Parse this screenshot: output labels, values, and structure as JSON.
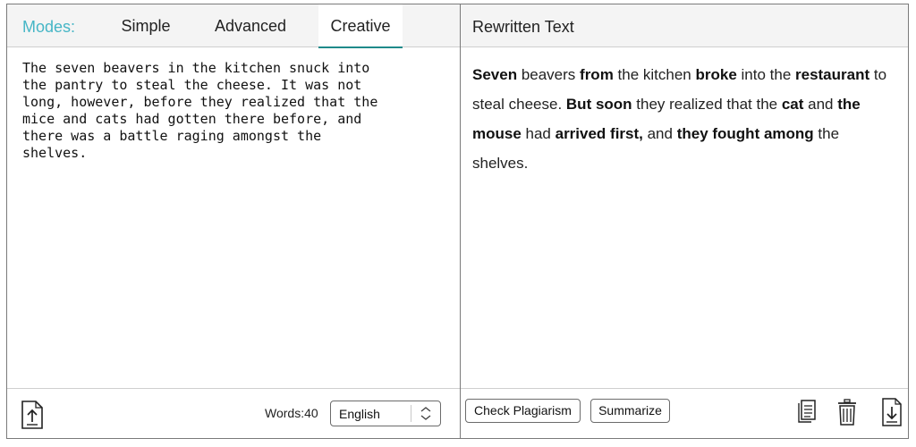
{
  "modes": {
    "label": "Modes:",
    "tabs": [
      {
        "label": "Simple"
      },
      {
        "label": "Advanced"
      },
      {
        "label": "Creative"
      }
    ],
    "active_tab": "Creative",
    "accent_color": "#46b6c6",
    "active_underline_color": "#1f8a8a"
  },
  "input": {
    "text": "The seven beavers in the kitchen snuck into\nthe pantry to steal the cheese. It was not\nlong, however, before they realized that the\nmice and cats had gotten there before, and\nthere was a battle raging amongst the\nshelves.",
    "words_label": "Words:",
    "words_count": "40",
    "language": "English"
  },
  "output": {
    "title": "Rewritten Text",
    "segments": [
      {
        "text": "Seven",
        "bold": true
      },
      {
        "text": " beavers ",
        "bold": false
      },
      {
        "text": "from",
        "bold": true
      },
      {
        "text": " the kitchen ",
        "bold": false
      },
      {
        "text": "broke",
        "bold": true
      },
      {
        "text": " into the ",
        "bold": false
      },
      {
        "text": "restaurant",
        "bold": true
      },
      {
        "text": " to steal cheese. ",
        "bold": false
      },
      {
        "text": "But soon",
        "bold": true
      },
      {
        "text": " they realized that the ",
        "bold": false
      },
      {
        "text": "cat",
        "bold": true
      },
      {
        "text": " and ",
        "bold": false
      },
      {
        "text": "the mouse",
        "bold": true
      },
      {
        "text": " had ",
        "bold": false
      },
      {
        "text": "arrived first,",
        "bold": true
      },
      {
        "text": " and ",
        "bold": false
      },
      {
        "text": "they fought among",
        "bold": true
      },
      {
        "text": " the shelves.",
        "bold": false
      }
    ],
    "buttons": {
      "check_plagiarism": "Check Plagiarism",
      "summarize": "Summarize"
    },
    "icons": [
      "copy-icon",
      "trash-icon",
      "download-icon"
    ]
  }
}
